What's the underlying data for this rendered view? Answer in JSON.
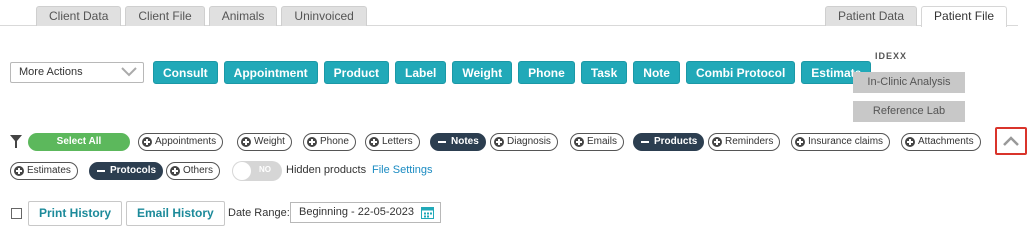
{
  "tabs_left": [
    "Client Data",
    "Client File",
    "Animals",
    "Uninvoiced"
  ],
  "tabs_right": [
    "Patient Data",
    "Patient File"
  ],
  "more_actions": "More Actions",
  "action_buttons": [
    "Consult",
    "Appointment",
    "Product",
    "Label",
    "Weight",
    "Phone",
    "Task",
    "Note",
    "Combi Protocol",
    "Estimate"
  ],
  "idexx": {
    "logo": "IDEXX",
    "in_clinic": "In-Clinic Analysis",
    "reference_lab": "Reference Lab"
  },
  "filters": {
    "select_all": "Select All",
    "row1": [
      {
        "label": "Appointments",
        "active": false
      },
      {
        "label": "Weight",
        "active": false
      },
      {
        "label": "Phone",
        "active": false
      },
      {
        "label": "Letters",
        "active": false
      },
      {
        "label": "Notes",
        "active": true
      },
      {
        "label": "Diagnosis",
        "active": false
      },
      {
        "label": "Emails",
        "active": false
      },
      {
        "label": "Products",
        "active": true
      },
      {
        "label": "Reminders",
        "active": false
      },
      {
        "label": "Insurance claims",
        "active": false
      },
      {
        "label": "Attachments",
        "active": false
      }
    ],
    "row2": [
      {
        "label": "Estimates",
        "active": false
      },
      {
        "label": "Protocols",
        "active": true
      },
      {
        "label": "Others",
        "active": false
      }
    ],
    "toggle_text": "NO",
    "hidden_products_label": "Hidden products",
    "file_settings": "File Settings"
  },
  "history": {
    "print": "Print History",
    "email": "Email History",
    "date_range_label": "Date Range:",
    "date_range_value": "Beginning - 22-05-2023"
  },
  "colors": {
    "accent": "#21a9b8",
    "select_all": "#5cb85c",
    "active_chip": "#2c3e50",
    "highlight": "#d9342b"
  }
}
